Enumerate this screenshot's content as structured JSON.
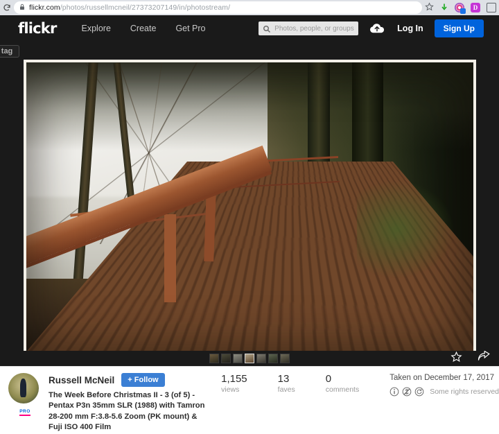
{
  "browser": {
    "reload_icon": "reload-icon",
    "lock_icon": "lock-icon",
    "url_host": "flickr.com",
    "url_path": "/photos/russellmcneil/27373207149/in/photostream/",
    "bookmark_icon": "star-outline-icon",
    "download_icon": "download-arrow-icon",
    "extension_1": "extension-icon",
    "extension_2": "D",
    "extension_3": "extension-icon"
  },
  "header": {
    "logo": "flickr",
    "nav": [
      {
        "label": "Explore"
      },
      {
        "label": "Create"
      },
      {
        "label": "Get Pro"
      }
    ],
    "search": {
      "placeholder": "Photos, people, or groups",
      "icon": "search-icon"
    },
    "upload_icon": "cloud-upload-icon",
    "login_label": "Log In",
    "signup_label": "Sign Up",
    "signup_color": "#0063dc"
  },
  "tagbar": {
    "chip_label": "o tag"
  },
  "photo": {
    "alt": "Wet wooden boardwalk with red railing through a misty winter forest",
    "frame_color": "#f3f0e8"
  },
  "filmstrip": {
    "count": 7,
    "selected_index": 3,
    "favorite_icon": "star-outline-icon",
    "share_icon": "share-arrow-icon"
  },
  "owner": {
    "avatar": "user-avatar",
    "pro_badge": "PRO",
    "name": "Russell McNeil",
    "follow_label": "+ Follow",
    "follow_color": "#3b7fd4",
    "photo_title": "The Week Before Christmas II - 3 (of 5) - Pentax P3n 35mm SLR (1988) with Tamron 28-200 mm F:3.8-5.6 Zoom (PK mount) & Fuji ISO 400 Film"
  },
  "stats": [
    {
      "value": "1,155",
      "label": "views"
    },
    {
      "value": "13",
      "label": "faves"
    },
    {
      "value": "0",
      "label": "comments"
    }
  ],
  "meta": {
    "taken_text": "Taken on December 17, 2017",
    "license_icons": [
      "cc-attribution-icon",
      "cc-noncommercial-icon",
      "cc-sharealike-icon"
    ],
    "rights_text": "Some rights reserved"
  }
}
